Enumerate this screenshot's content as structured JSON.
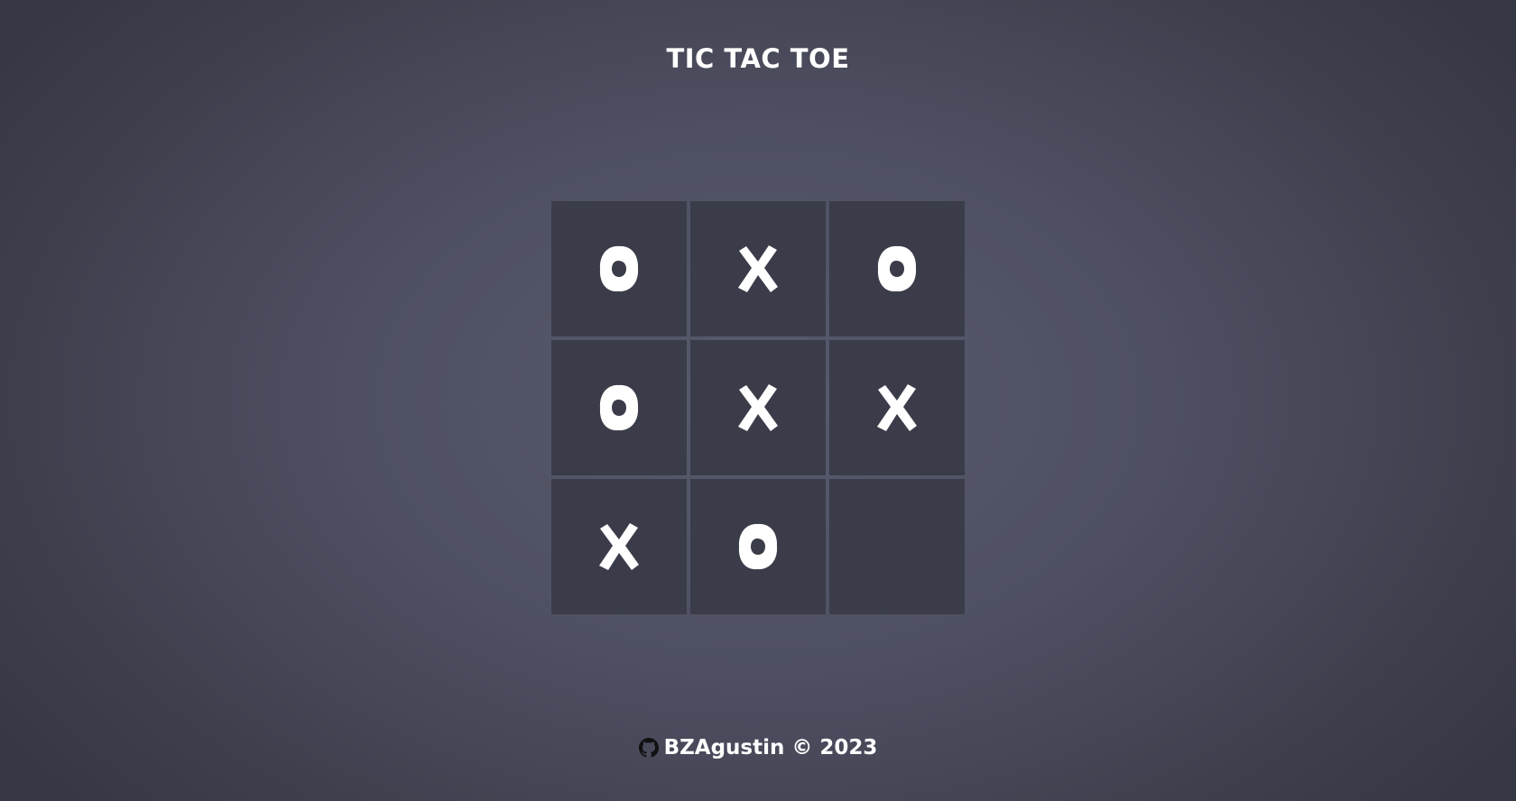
{
  "title": "TIC TAC TOE",
  "board": {
    "cells": [
      "O",
      "X",
      "O",
      "O",
      "X",
      "X",
      "X",
      "O",
      ""
    ]
  },
  "footer": {
    "icon": "github-icon",
    "text": "BZAgustin © 2023"
  },
  "colors": {
    "cell_background": "#3b3c49",
    "mark": "#ffffff"
  }
}
